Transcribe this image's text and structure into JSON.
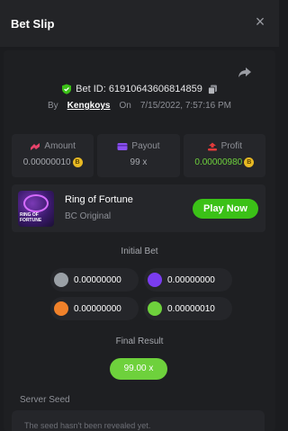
{
  "header": {
    "title": "Bet Slip",
    "close_glyph": "×"
  },
  "bet": {
    "id_label": "Bet ID: 61910643606814859",
    "by": "By",
    "user": "Kengkoys",
    "on": "On",
    "datetime": "7/15/2022, 7:57:16 PM"
  },
  "stats": {
    "amount": {
      "label": "Amount",
      "value": "0.00000010"
    },
    "payout": {
      "label": "Payout",
      "value": "99 x"
    },
    "profit": {
      "label": "Profit",
      "value": "0.00000980"
    }
  },
  "game": {
    "name": "Ring of Fortune",
    "provider": "BC Original",
    "play_label": "Play Now",
    "thumb_text": "RING OF FORTUNE"
  },
  "initial_bet": {
    "title": "Initial Bet",
    "items": [
      {
        "value": "0.00000000",
        "color": "#9aa0a6"
      },
      {
        "value": "0.00000000",
        "color": "#7a3cf0"
      },
      {
        "value": "0.00000000",
        "color": "#f0812a"
      },
      {
        "value": "0.00000010",
        "color": "#6ed13c"
      }
    ]
  },
  "final_result": {
    "title": "Final Result",
    "value": "99.00 x"
  },
  "server_seed": {
    "label": "Server Seed",
    "text": "The seed hasn't been revealed yet."
  },
  "colors": {
    "accent_green": "#3bc117",
    "profit_green": "#6ed13c",
    "coin": "#e8b923"
  }
}
